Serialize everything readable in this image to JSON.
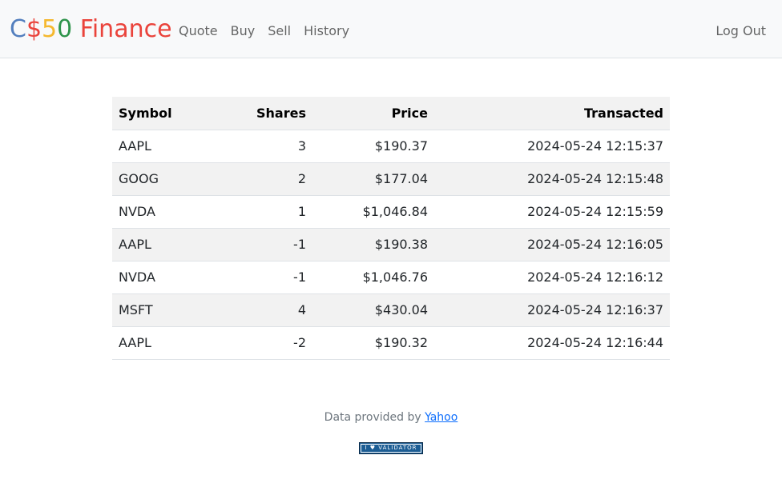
{
  "navbar": {
    "brand": {
      "c1": "C",
      "c2": "$",
      "c3": "5",
      "c4": "0",
      "c5": " Finance"
    },
    "links": [
      "Quote",
      "Buy",
      "Sell",
      "History"
    ],
    "logout": "Log Out"
  },
  "table": {
    "headers": [
      "Symbol",
      "Shares",
      "Price",
      "Transacted"
    ],
    "rows": [
      [
        "AAPL",
        "3",
        "$190.37",
        "2024-05-24 12:15:37"
      ],
      [
        "GOOG",
        "2",
        "$177.04",
        "2024-05-24 12:15:48"
      ],
      [
        "NVDA",
        "1",
        "$1,046.84",
        "2024-05-24 12:15:59"
      ],
      [
        "AAPL",
        "-1",
        "$190.38",
        "2024-05-24 12:16:05"
      ],
      [
        "NVDA",
        "-1",
        "$1,046.76",
        "2024-05-24 12:16:12"
      ],
      [
        "MSFT",
        "4",
        "$430.04",
        "2024-05-24 12:16:37"
      ],
      [
        "AAPL",
        "-2",
        "$190.32",
        "2024-05-24 12:16:44"
      ]
    ]
  },
  "footer": {
    "prefix": "Data provided by ",
    "link": "Yahoo",
    "badge": "I ♥ VALIDATOR"
  },
  "colors": {
    "brand_blue": "#537fbe",
    "brand_red": "#ea433b",
    "brand_yellow": "#f5b82e",
    "brand_green": "#2e944b",
    "navbar_bg": "#f8f9fa",
    "stripe_bg": "#f2f2f2",
    "link_blue": "#0d6efd"
  }
}
